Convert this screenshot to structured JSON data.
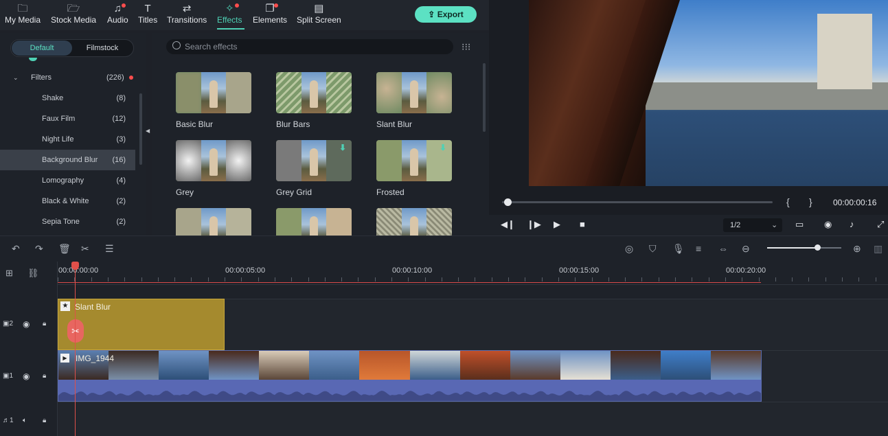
{
  "nav": {
    "items": [
      {
        "label": "My Media",
        "icon": "folder-icon",
        "glyph": "🗀"
      },
      {
        "label": "Stock Media",
        "icon": "stock-folder-icon",
        "glyph": "🗁"
      },
      {
        "label": "Audio",
        "icon": "music-note-icon",
        "glyph": "♫"
      },
      {
        "label": "Titles",
        "icon": "text-icon",
        "glyph": "T"
      },
      {
        "label": "Transitions",
        "icon": "transition-icon",
        "glyph": "⇄"
      },
      {
        "label": "Effects",
        "icon": "effects-icon",
        "glyph": "✧"
      },
      {
        "label": "Elements",
        "icon": "elements-icon",
        "glyph": "❐"
      },
      {
        "label": "Split Screen",
        "icon": "split-screen-icon",
        "glyph": "▤"
      }
    ],
    "export_label": "Export",
    "export_icon": "⇪"
  },
  "sidebar": {
    "tab_default": "Default",
    "tab_filmstock": "Filmstock",
    "filters_label": "Filters",
    "filters_count": "(226)",
    "categories": [
      {
        "name": "Shake",
        "count": "(8)"
      },
      {
        "name": "Faux Film",
        "count": "(12)"
      },
      {
        "name": "Night Life",
        "count": "(3)"
      },
      {
        "name": "Background Blur",
        "count": "(16)"
      },
      {
        "name": "Lomography",
        "count": "(4)"
      },
      {
        "name": "Black & White",
        "count": "(2)"
      },
      {
        "name": "Sepia Tone",
        "count": "(2)"
      }
    ],
    "selected": "Background Blur"
  },
  "effects": {
    "search_placeholder": "Search effects",
    "cards": [
      {
        "label": "Basic Blur",
        "download": false
      },
      {
        "label": "Blur Bars",
        "download": false
      },
      {
        "label": "Slant Blur",
        "download": false
      },
      {
        "label": "Grey",
        "download": false
      },
      {
        "label": "Grey Grid",
        "download": true
      },
      {
        "label": "Frosted",
        "download": true
      },
      {
        "label": "",
        "download": false
      },
      {
        "label": "",
        "download": false
      },
      {
        "label": "",
        "download": false
      }
    ]
  },
  "preview": {
    "timecode": "00:00:00:16",
    "brace_open": "{",
    "brace_close": "}",
    "ratio": "1/2",
    "progress_fraction": 0.02
  },
  "timeline": {
    "ruler_labels": [
      "00:00:00:00",
      "00:00:05:00",
      "00:00:10:00",
      "00:00:15:00",
      "00:00:20:00"
    ],
    "fx_clip_label": "Slant Blur",
    "video_clip_label": "IMG_1944",
    "tracks": [
      {
        "id": "2",
        "type": "video"
      },
      {
        "id": "1",
        "type": "video"
      },
      {
        "id": "1",
        "type": "audio"
      }
    ],
    "zoom_fraction": 0.67
  },
  "colors": {
    "accent": "#4fd1b5",
    "export_bg": "#5ce1c3",
    "playhead": "#e0504a",
    "fx_clip": "#a58a2e",
    "video_clip": "#5968b4"
  }
}
